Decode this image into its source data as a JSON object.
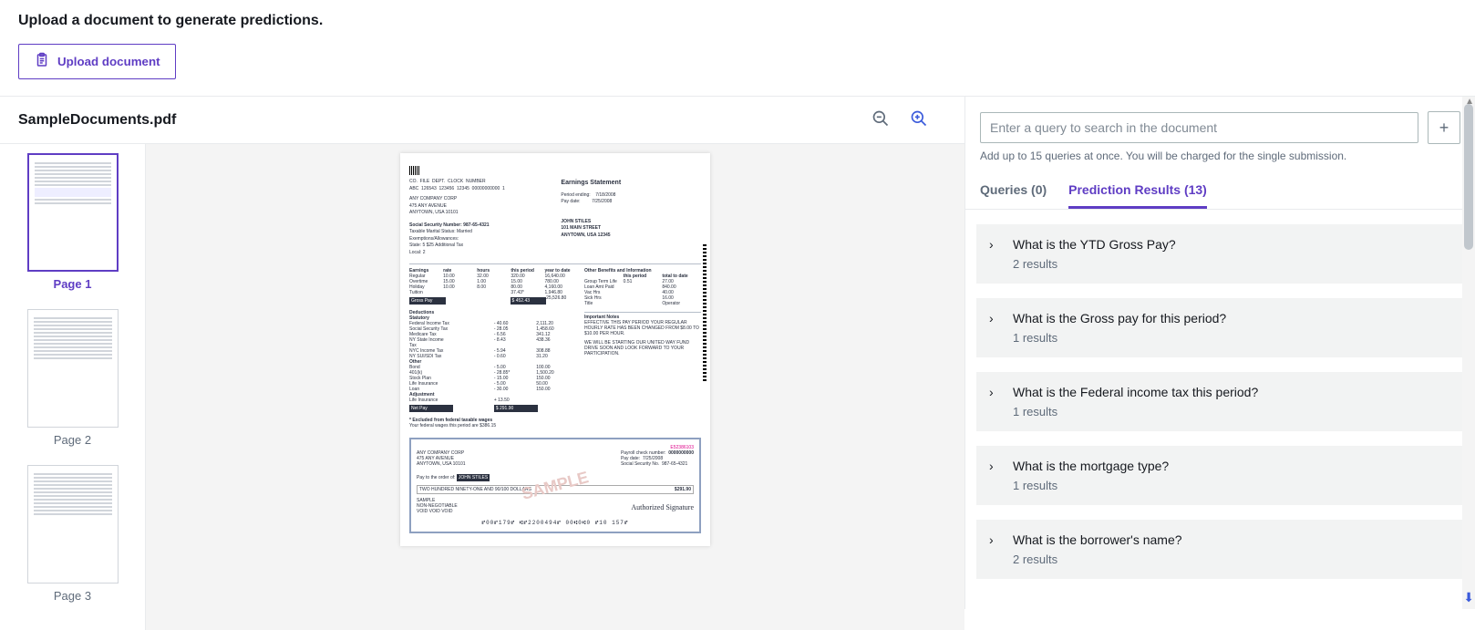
{
  "top": {
    "title": "Upload a document to generate predictions.",
    "upload_label": "Upload document"
  },
  "doc": {
    "name": "SampleDocuments.pdf"
  },
  "thumbs": [
    {
      "label": "Page 1",
      "selected": true
    },
    {
      "label": "Page 2",
      "selected": false
    },
    {
      "label": "Page 3",
      "selected": false
    }
  ],
  "paystub": {
    "title": "Earnings Statement",
    "company": "ANY COMPANY CORP",
    "addr1": "475 ANY AVENUE",
    "addr2": "ANYTOWN, USA 10101",
    "period_ending_label": "Period ending:",
    "period_ending": "7/18/2008",
    "pay_date_label": "Pay date:",
    "pay_date": "7/25/2008",
    "employee": "JOHN STILES",
    "emp_addr1": "101 MAIN STREET",
    "emp_addr2": "ANYTOWN, USA 12345",
    "ssn_label": "Social Security Number: 987-65-4321",
    "marital": "Taxable Marital Status: Married",
    "exemptions": "Exemptions/Allowances:",
    "state_line": "State: 5 $25 Additional Tax",
    "local_line": "Local: 2",
    "earnings_header": "Earnings",
    "rate_header": "rate",
    "hours_header": "hours",
    "this_period_header": "this period",
    "ytd_header": "year to date",
    "earnings": [
      {
        "label": "Regular",
        "rate": "10.00",
        "hours": "32.00",
        "tp": "320.00",
        "ytd": "16,640.00"
      },
      {
        "label": "Overtime",
        "rate": "15.00",
        "hours": "1.00",
        "tp": "15.00",
        "ytd": "780.00"
      },
      {
        "label": "Holiday",
        "rate": "10.00",
        "hours": "8.00",
        "tp": "80.00",
        "ytd": "4,160.00"
      },
      {
        "label": "Tuition",
        "rate": "",
        "hours": "",
        "tp": "37.43*",
        "ytd": "1,946.80"
      }
    ],
    "gross_label": "Gross Pay",
    "gross_tp": "$ 452.43",
    "gross_ytd": "25,526.80",
    "deductions_header": "Deductions",
    "statutory_header": "Statutory",
    "statutory": [
      {
        "label": "Federal Income Tax",
        "tp": "- 40.60",
        "ytd": "2,111.20"
      },
      {
        "label": "Social Security Tax",
        "tp": "- 28.05",
        "ytd": "1,458.60"
      },
      {
        "label": "Medicare Tax",
        "tp": "- 6.56",
        "ytd": "341.12"
      },
      {
        "label": "NY State Income Tax",
        "tp": "- 8.43",
        "ytd": "438.36"
      },
      {
        "label": "NYC Income Tax",
        "tp": "- 5.94",
        "ytd": "308.88"
      },
      {
        "label": "NY SUI/SDI Tax",
        "tp": "- 0.60",
        "ytd": "31.20"
      }
    ],
    "other_header": "Other",
    "other": [
      {
        "label": "Bond",
        "tp": "- 5.00",
        "ytd": "100.00"
      },
      {
        "label": "401(k)",
        "tp": "- 28.85*",
        "ytd": "1,500.20"
      },
      {
        "label": "Stock Plan",
        "tp": "- 15.00",
        "ytd": "150.00"
      },
      {
        "label": "Life Insurance",
        "tp": "- 5.00",
        "ytd": "50.00"
      },
      {
        "label": "Loan",
        "tp": "- 30.00",
        "ytd": "150.00"
      }
    ],
    "adj_header": "Adjustment",
    "adj": {
      "label": "Life Insurance",
      "tp": "+ 13.50"
    },
    "net_label": "Net Pay",
    "net_tp": "$ 291.90",
    "excluded": "* Excluded from federal taxable wages",
    "fed_wages": "Your federal wages this period are $386.15",
    "benefits_header": "Other Benefits and Information",
    "benefits_tp": "this period",
    "benefits_ttd": "total to date",
    "benefits": [
      {
        "label": "Group Term Life",
        "tp": "0.51",
        "ttd": "27.00"
      },
      {
        "label": "Loan Amt Paid",
        "tp": "",
        "ttd": "840.00"
      },
      {
        "label": "Vac Hrs",
        "tp": "",
        "ttd": "40.00"
      },
      {
        "label": "Sick Hrs",
        "tp": "",
        "ttd": "16.00"
      },
      {
        "label": "Title",
        "tp": "",
        "ttd": "Operator"
      }
    ],
    "notes_header": "Important Notes",
    "notes1": "EFFECTIVE THIS PAY PERIOD YOUR REGULAR HOURLY RATE HAS BEEN CHANGED FROM $8.00 TO $10.00 PER HOUR.",
    "notes2": "WE WILL BE STARTING OUR UNITED WAY FUND DRIVE SOON AND LOOK FORWARD TO YOUR PARTICIPATION.",
    "check_serial": "E52386103",
    "check_company": "ANY COMPANY CORP",
    "check_addr1": "475 ANY AVENUE",
    "check_addr2": "ANYTOWN, USA 10101",
    "paynum_label": "Payroll check number:",
    "paynum": "0000000000",
    "paydate_label": "Pay date:",
    "paydate": "7/25/2008",
    "ssn_check_label": "Social Security No.",
    "ssn_check": "987-65-4321",
    "pay_to_label": "Pay to the order of:",
    "pay_to": "JOHN STILES",
    "amount_words": "TWO HUNDRED NINETY-ONE AND 90/100 DOLLARS",
    "amount": "$291.90",
    "sample": "SAMPLE",
    "nonneg": "NON-NEGOTIABLE",
    "void": "VOID VOID VOID",
    "sig": "Authorized Signature",
    "micr": "⑈00⑈179⑈ ⑆⑈2200494⑈ 00⑆0⑆0 ⑈10 157⑈"
  },
  "query": {
    "placeholder": "Enter a query to search in the document",
    "hint": "Add up to 15 queries at once. You will be charged for the single submission."
  },
  "tabs": {
    "queries": "Queries (0)",
    "results": "Prediction Results (13)"
  },
  "results": [
    {
      "q": "What is the YTD Gross Pay?",
      "cnt": "2 results"
    },
    {
      "q": "What is the Gross pay for this period?",
      "cnt": "1 results"
    },
    {
      "q": "What is the Federal income tax this period?",
      "cnt": "1 results"
    },
    {
      "q": "What is the mortgage type?",
      "cnt": "1 results"
    },
    {
      "q": "What is the borrower's name?",
      "cnt": "2 results"
    }
  ]
}
